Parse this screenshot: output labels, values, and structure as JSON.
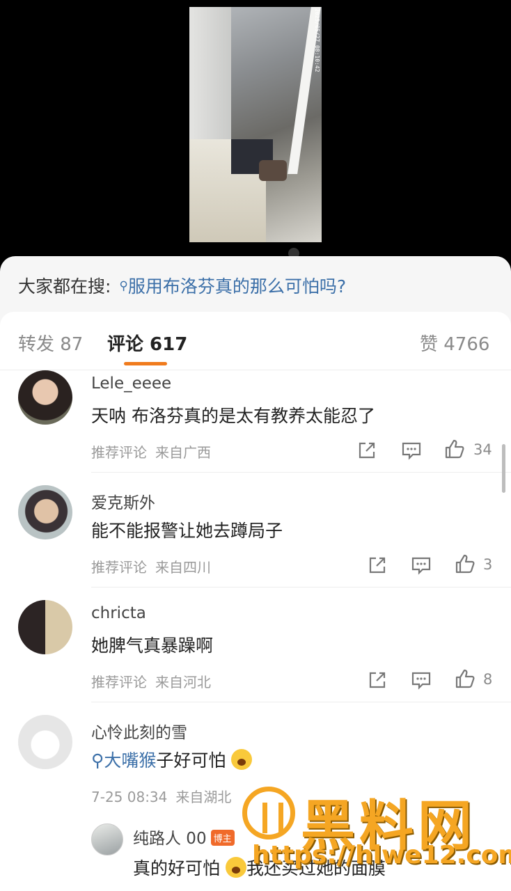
{
  "video": {
    "timestamp": "2025/05/27 08:10:42"
  },
  "search_hint": {
    "prefix": "大家都在搜:",
    "query": "服用布洛芬真的那么可怕吗?",
    "icon": "search-icon"
  },
  "tabs": {
    "repost": "转发 87",
    "comments": "评论 617",
    "likes": "赞 4766",
    "accent_color": "#f07b1d"
  },
  "comments": [
    {
      "name": "Lele_eeee",
      "text": "天呐 布洛芬真的是太有教养太能忍了",
      "tag": "推荐评论",
      "location": "来自广西",
      "likes": "34"
    },
    {
      "name": "爱克斯外",
      "text": "能不能报警让她去蹲局子",
      "tag": "推荐评论",
      "location": "来自四川",
      "likes": "3"
    },
    {
      "name": "chricta",
      "text": "她脾气真暴躁啊",
      "tag": "推荐评论",
      "location": "来自河北",
      "likes": "8"
    },
    {
      "name": "心怜此刻的雪",
      "text_link": "大嘴猴",
      "text_rest": "子好可怕",
      "date": "7-25 08:34",
      "location": "来自湖北",
      "reply": {
        "name": "纯路人 00",
        "badge": "博主",
        "text": "真的好可怕",
        "text_rest": "我还买过她的面膜"
      }
    }
  ],
  "watermark": {
    "title": "黑料网",
    "url": "https://hlwe12.com"
  }
}
